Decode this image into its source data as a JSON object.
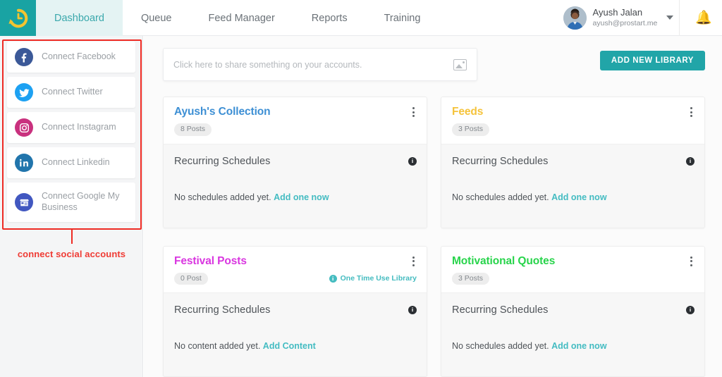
{
  "nav": {
    "logo_icon": "history-clock-icon",
    "items": [
      {
        "label": "Dashboard",
        "active": true
      },
      {
        "label": "Queue",
        "active": false
      },
      {
        "label": "Feed Manager",
        "active": false
      },
      {
        "label": "Reports",
        "active": false
      },
      {
        "label": "Training",
        "active": false
      }
    ],
    "user": {
      "name": "Ayush Jalan",
      "email": "ayush@prostart.me"
    },
    "bell_icon": "notification-bell-icon",
    "caret_icon": "chevron-down-icon"
  },
  "sidebar": {
    "accounts": [
      {
        "label": "Connect Facebook",
        "icon": "facebook-icon",
        "color": "#3b5998"
      },
      {
        "label": "Connect Twitter",
        "icon": "twitter-icon",
        "color": "#1da1f2"
      },
      {
        "label": "Connect Instagram",
        "icon": "instagram-icon",
        "color": "#c9317e"
      },
      {
        "label": "Connect Linkedin",
        "icon": "linkedin-icon",
        "color": "#2175ac"
      },
      {
        "label": "Connect Google My Business",
        "icon": "google-my-business-icon",
        "color": "#4157c0"
      }
    ]
  },
  "annotation": {
    "text": "connect social accounts",
    "color": "#ef3b34"
  },
  "composer": {
    "placeholder": "Click here to share something on your accounts.",
    "image_icon": "image-upload-icon"
  },
  "toolbar": {
    "add_library_label": "ADD NEW LIBRARY",
    "accent": "#21a5a8"
  },
  "cards": [
    {
      "title": "Ayush's Collection",
      "title_color": "#3d8fd4",
      "posts": "8 Posts",
      "one_time": null,
      "section_title": "Recurring Schedules",
      "empty_text": "No schedules added yet.",
      "empty_link": "Add one now"
    },
    {
      "title": "Feeds",
      "title_color": "#f5c33b",
      "posts": "3 Posts",
      "one_time": null,
      "section_title": "Recurring Schedules",
      "empty_text": "No schedules added yet.",
      "empty_link": "Add one now"
    },
    {
      "title": "Festival Posts",
      "title_color": "#d936e0",
      "posts": "0 Post",
      "one_time": "One Time Use Library",
      "section_title": "Recurring Schedules",
      "empty_text": "No content added yet.",
      "empty_link": "Add Content"
    },
    {
      "title": "Motivational Quotes",
      "title_color": "#28d44b",
      "posts": "3 Posts",
      "one_time": null,
      "section_title": "Recurring Schedules",
      "empty_text": "No schedules added yet.",
      "empty_link": "Add one now"
    }
  ]
}
